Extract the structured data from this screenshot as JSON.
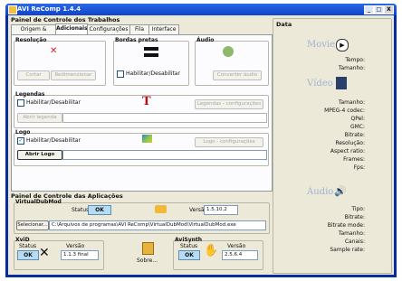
{
  "window": {
    "title": "AVI ReComp 1.4.4",
    "min": "_",
    "max": "□",
    "close": "X"
  },
  "tasks": {
    "title": "Painel de Controle dos Trabalhos",
    "tabs": [
      "Origem & Destino",
      "Adicionais",
      "Configurações",
      "Fila",
      "Interface"
    ],
    "selected_tab": 1,
    "resolution": {
      "title": "Resolução",
      "crop": "Cortar",
      "resize": "Redimensionar"
    },
    "bars": {
      "title": "Bordas pretas",
      "check": "Habilitar/Desabilitar"
    },
    "audio": {
      "title": "Áudio",
      "button": "Converter áudio"
    },
    "subtitles": {
      "title": "Legendas",
      "check": "Habilitar/Desabilitar",
      "open": "Abrir legenda",
      "config": "Legendas - configurações"
    },
    "logo": {
      "title": "Logo",
      "check": "Habilitar/Desabilitar",
      "open": "Abrir Logo",
      "config": "Logo - configurações",
      "path": ""
    }
  },
  "apps": {
    "title": "Painel de Controle das Aplicações",
    "virtualdub": {
      "title": "VirtualDubMod",
      "status_label": "Status",
      "status": "OK",
      "version_label": "Versão",
      "version": "1.5.10.2",
      "select": "Selecionar...",
      "path": "C:\\Arquivos de programas\\AVI ReComp\\VirtualDubMod\\VirtualDubMod.exe"
    },
    "xvid": {
      "title": "XviD",
      "status_label": "Status",
      "status": "OK",
      "version_label": "Versão",
      "version": "1.1.3 final"
    },
    "about": {
      "label": "Sobre..."
    },
    "avisynth": {
      "title": "AviSynth",
      "status_label": "Status",
      "status": "OK",
      "version_label": "Versão",
      "version": "2.5.6.4"
    }
  },
  "data": {
    "title": "Data",
    "movie": {
      "title": "Movie",
      "fields": [
        "Tempo:",
        "Tamanho:"
      ]
    },
    "video": {
      "title": "Vídeo",
      "fields": [
        "Tamanho:",
        "MPEG-4 codec:",
        "QPel:",
        "GMC:",
        "Bitrate:",
        "Resolução:",
        "Aspect ratio:",
        "Frames:",
        "Fps:"
      ]
    },
    "audio": {
      "title": "Áudio",
      "fields": [
        "Tipo:",
        "Bitrate:",
        "Bitrate mode:",
        "Tamanho:",
        "Canais:",
        "Sample rate:"
      ]
    }
  },
  "colors": {
    "accent": "#0a2d9e",
    "status_ok": "#b7dcf7",
    "section_title": "#9fb2d4"
  },
  "icons": [
    "crop-arrows-icon",
    "black-bars-icon",
    "audio-convert-icon",
    "subtitle-tt-icon",
    "logo-image-icon",
    "folder-icon",
    "xvid-logo-icon",
    "about-book-icon",
    "avisynth-hand-icon",
    "play-icon",
    "film-icon",
    "speaker-icon"
  ]
}
